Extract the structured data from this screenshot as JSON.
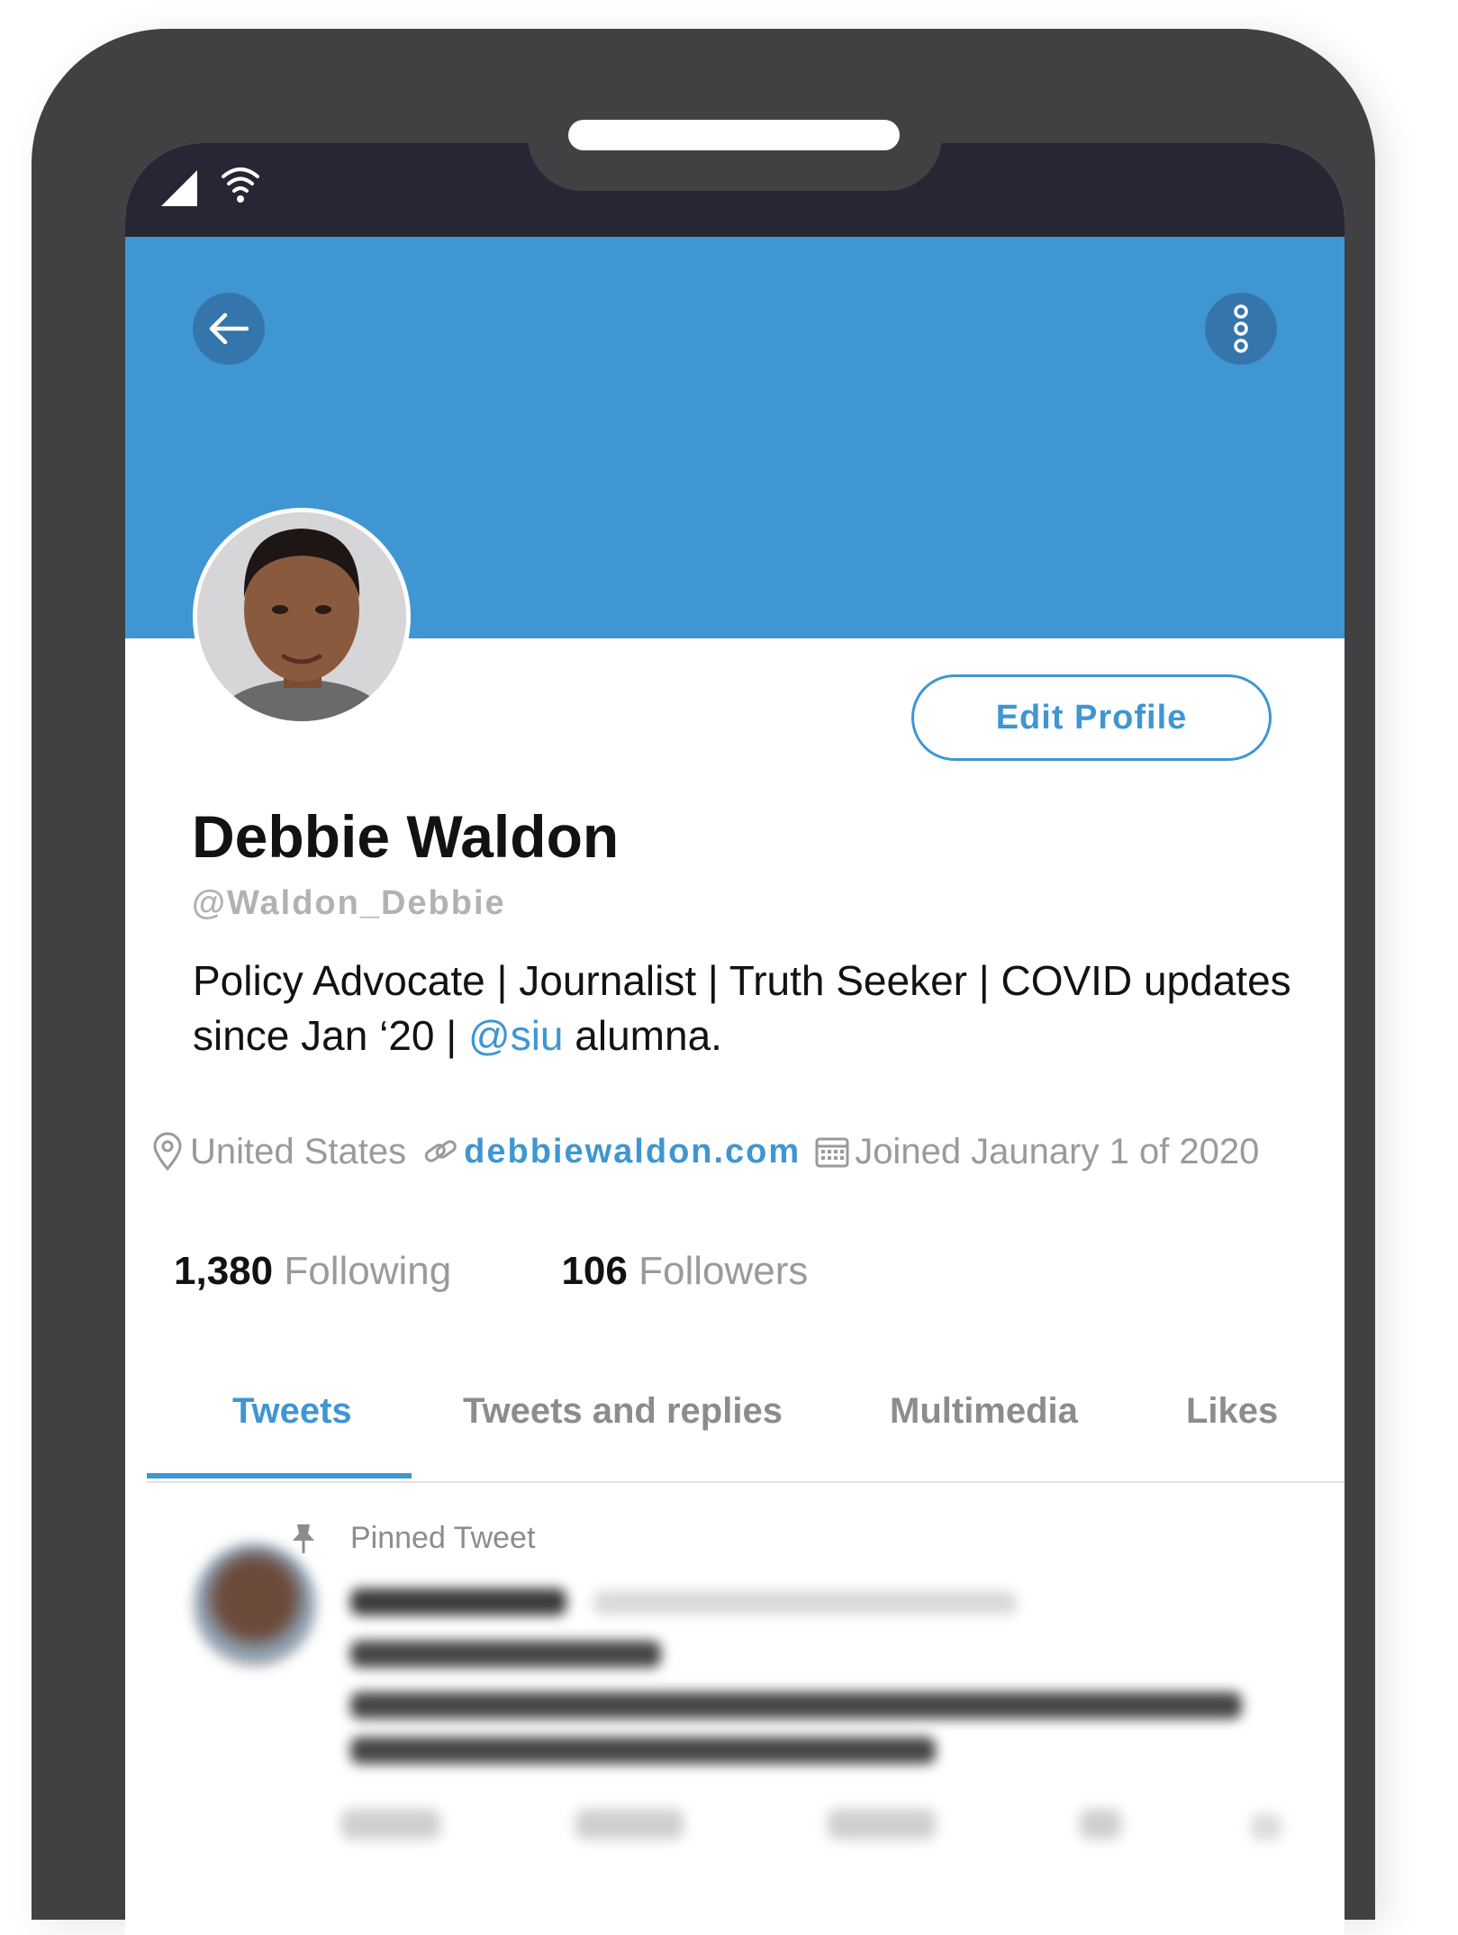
{
  "profile": {
    "name": "Debbie Waldon",
    "handle": "@Waldon_Debbie",
    "edit_label": "Edit Profile",
    "bio_text": "Policy Advocate | Journalist | Truth Seeker | COVID updates since Jan ‘20 | ",
    "bio_mention": "@siu",
    "bio_suffix": " alumna.",
    "location": "United States",
    "website": "debbiewaldon.com",
    "joined": "Joined Jaunary 1 of 2020"
  },
  "stats": {
    "following_count": "1,380",
    "following_label": "Following",
    "followers_count": "106",
    "followers_label": "Followers"
  },
  "tabs": [
    {
      "label": "Tweets",
      "active": true
    },
    {
      "label": "Tweets and replies",
      "active": false
    },
    {
      "label": "Multimedia",
      "active": false
    },
    {
      "label": "Likes",
      "active": false
    }
  ],
  "pinned_label": "Pinned Tweet",
  "icons": {
    "back": "arrow-left-icon",
    "more": "more-vertical-icon",
    "location": "map-pin-icon",
    "website": "link-icon",
    "joined": "calendar-icon",
    "pin": "pin-icon"
  },
  "colors": {
    "accent": "#3f96d2",
    "banner": "#3f96d2",
    "phone_frame": "#414042",
    "status_bar": "#262635"
  }
}
